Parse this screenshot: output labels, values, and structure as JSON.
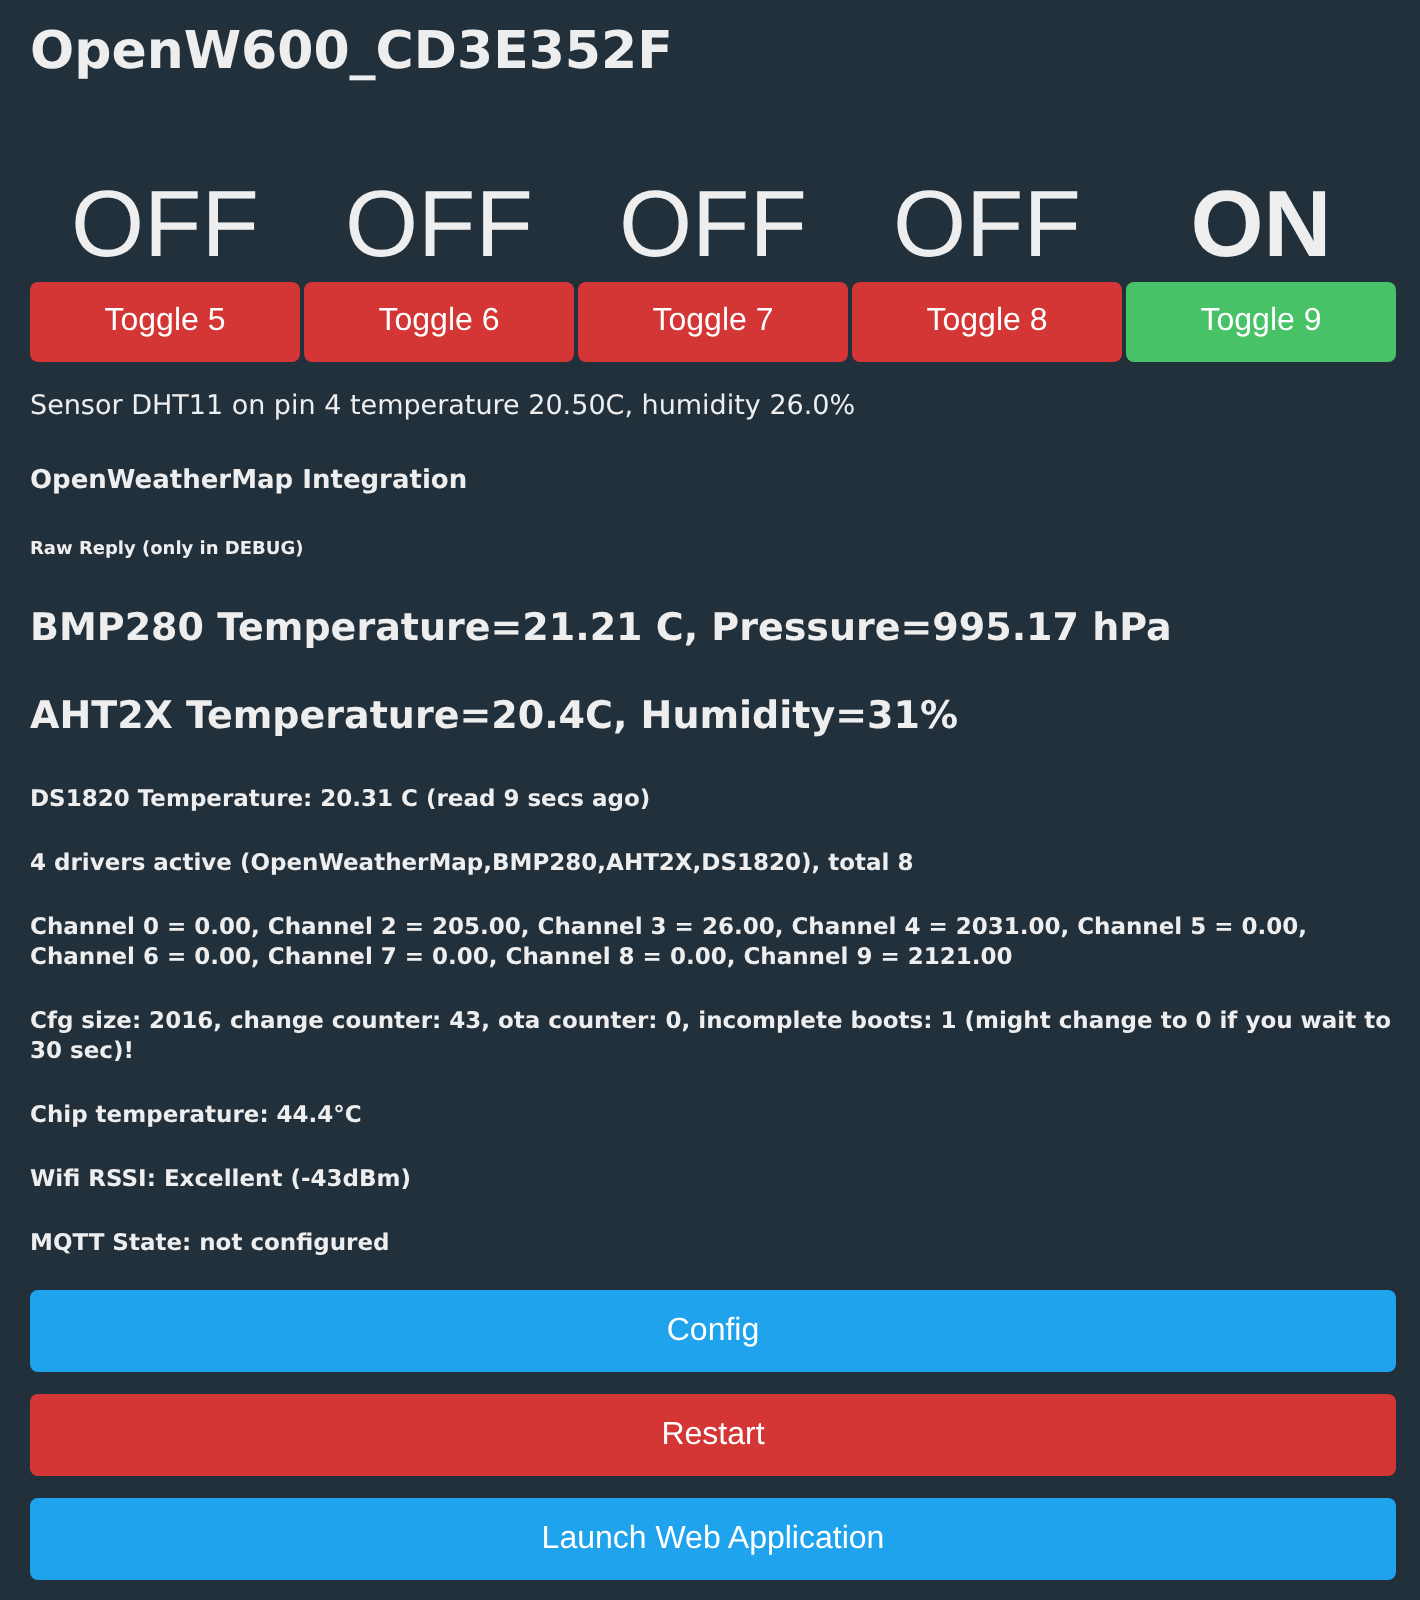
{
  "title": "OpenW600_CD3E352F",
  "toggles": [
    {
      "state": "OFF",
      "on": false,
      "label": "Toggle 5"
    },
    {
      "state": "OFF",
      "on": false,
      "label": "Toggle 6"
    },
    {
      "state": "OFF",
      "on": false,
      "label": "Toggle 7"
    },
    {
      "state": "OFF",
      "on": false,
      "label": "Toggle 8"
    },
    {
      "state": "ON",
      "on": true,
      "label": "Toggle 9"
    }
  ],
  "lines": [
    {
      "kind": "plain",
      "text": "Sensor DHT11 on pin 4 temperature 20.50C, humidity 26.0%"
    },
    {
      "kind": "heading",
      "text": "OpenWeatherMap Integration"
    },
    {
      "kind": "tiny",
      "text": "Raw Reply (only in DEBUG)"
    },
    {
      "kind": "large",
      "text": "BMP280 Temperature=21.21 C, Pressure=995.17 hPa"
    },
    {
      "kind": "large",
      "text": "AHT2X Temperature=20.4C, Humidity=31%"
    },
    {
      "kind": "info",
      "text": "DS1820 Temperature: 20.31 C (read 9 secs ago)"
    },
    {
      "kind": "info",
      "text": "4 drivers active (OpenWeatherMap,BMP280,AHT2X,DS1820), total 8"
    },
    {
      "kind": "info",
      "text": "Channel 0 = 0.00, Channel 2 = 205.00, Channel 3 = 26.00, Channel 4 = 2031.00, Channel 5 = 0.00, Channel 6 = 0.00, Channel 7 = 0.00, Channel 8 = 0.00, Channel 9 = 2121.00"
    },
    {
      "kind": "info",
      "text": "Cfg size: 2016, change counter: 43, ota counter: 0, incomplete boots: 1 (might change to 0 if you wait to 30 sec)!"
    },
    {
      "kind": "info",
      "text": "Chip temperature: 44.4°C"
    },
    {
      "kind": "info",
      "text": "Wifi RSSI: Excellent (-43dBm)"
    },
    {
      "kind": "info",
      "text": "MQTT State: not configured"
    }
  ],
  "buttons": [
    {
      "kind": "normal",
      "label": "Config"
    },
    {
      "kind": "danger",
      "label": "Restart"
    },
    {
      "kind": "normal",
      "label": "Launch Web Application"
    }
  ]
}
